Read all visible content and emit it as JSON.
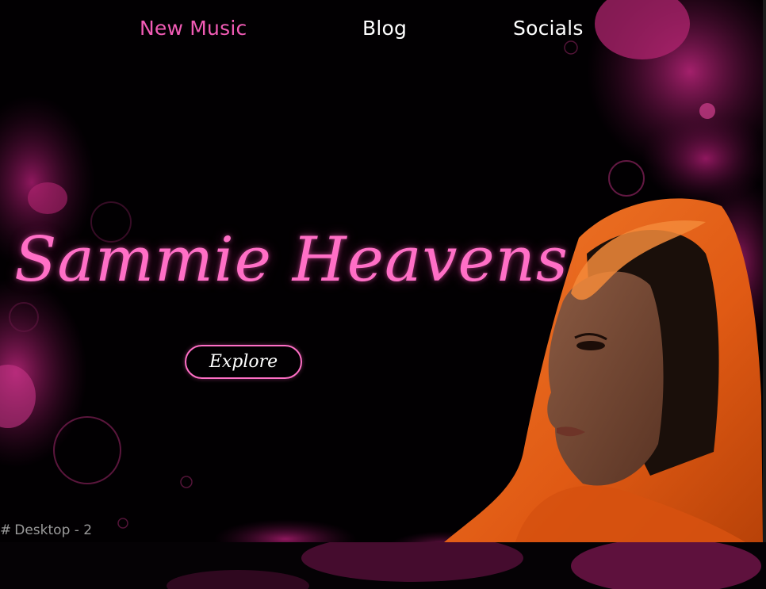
{
  "nav": {
    "items": [
      {
        "label": "New Music",
        "active": true
      },
      {
        "label": "Blog",
        "active": false
      },
      {
        "label": "Socials",
        "active": false
      }
    ]
  },
  "hero": {
    "title": "Sammie Heavens",
    "button_label": "Explore"
  },
  "editor": {
    "frame_label": "Desktop - 2",
    "frame_icon": "frame-icon"
  },
  "colors": {
    "accent": "#ff6fc6",
    "active_nav": "#f15bb5",
    "background": "#020002",
    "scarf": "#e8611a"
  }
}
